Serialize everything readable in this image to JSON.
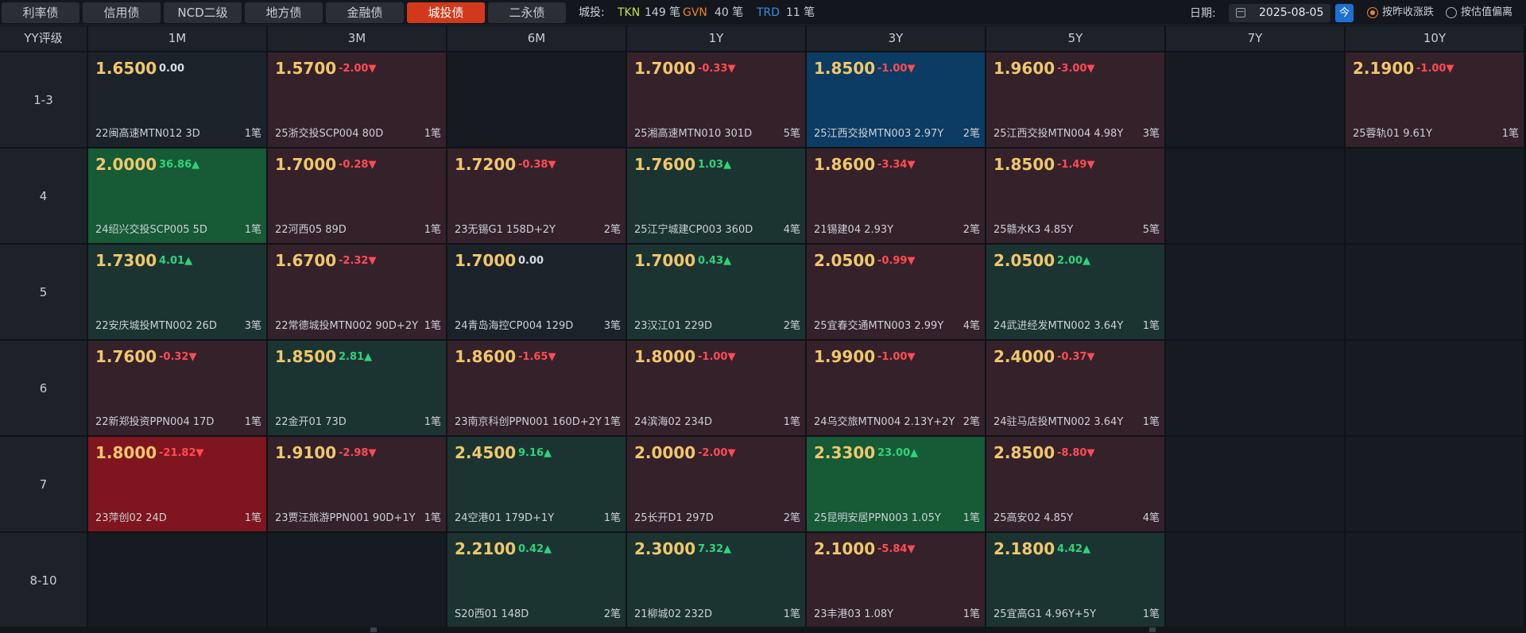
{
  "tabs": [
    {
      "label": "利率债",
      "active": false
    },
    {
      "label": "信用债",
      "active": false
    },
    {
      "label": "NCD二级",
      "active": false
    },
    {
      "label": "地方债",
      "active": false
    },
    {
      "label": "金融债",
      "active": false
    },
    {
      "label": "城投债",
      "active": true
    },
    {
      "label": "二永债",
      "active": false
    }
  ],
  "stats": {
    "label": "城投:",
    "items": [
      {
        "key": "TKN",
        "count": "149 笔",
        "color": "#c4e04b"
      },
      {
        "key": "GVN",
        "count": "40 笔",
        "color": "#e8822a"
      },
      {
        "key": "TRD",
        "count": "11 笔",
        "color": "#3a8fe0"
      }
    ]
  },
  "date": {
    "label": "日期:",
    "value": "2025-08-05",
    "today_label": "今"
  },
  "options": [
    {
      "label": "按昨收涨跌",
      "selected": true
    },
    {
      "label": "按估值偏离",
      "selected": false
    }
  ],
  "colors": {
    "accent": "#d2391c",
    "yield": "#f0c76a",
    "down": "#ff4b55",
    "up": "#2fd37b"
  },
  "grid": {
    "corner": "YY评级",
    "columns": [
      "1M",
      "3M",
      "6M",
      "1Y",
      "3Y",
      "5Y",
      "7Y",
      "10Y"
    ],
    "rows": [
      {
        "label": "1-3",
        "cells": [
          {
            "yield": "1.6500",
            "chg": "0.00",
            "dir": "zero",
            "tone": "flat",
            "name": "22闽高速MTN012 3D",
            "count": "1笔"
          },
          {
            "yield": "1.5700",
            "chg": "-2.00▼",
            "dir": "neg",
            "tone": "down",
            "name": "25浙交投SCP004 80D",
            "count": "1笔"
          },
          null,
          {
            "yield": "1.7000",
            "chg": "-0.33▼",
            "dir": "neg",
            "tone": "down",
            "name": "25湘高速MTN010 301D",
            "count": "5笔"
          },
          {
            "yield": "1.8500",
            "chg": "-1.00▼",
            "dir": "neg",
            "tone": "blue",
            "name": "25江西交投MTN003 2.97Y",
            "count": "2笔"
          },
          {
            "yield": "1.9600",
            "chg": "-3.00▼",
            "dir": "neg",
            "tone": "down",
            "name": "25江西交投MTN004 4.98Y",
            "count": "3笔"
          },
          null,
          {
            "yield": "2.1900",
            "chg": "-1.00▼",
            "dir": "neg",
            "tone": "down",
            "name": "25蓉轨01 9.61Y",
            "count": "1笔"
          }
        ]
      },
      {
        "label": "4",
        "cells": [
          {
            "yield": "2.0000",
            "chg": "36.86▲",
            "dir": "pos",
            "tone": "up-strong",
            "name": "24绍兴交投SCP005 5D",
            "count": "1笔"
          },
          {
            "yield": "1.7000",
            "chg": "-0.28▼",
            "dir": "neg",
            "tone": "down",
            "name": "22河西05 89D",
            "count": "1笔"
          },
          {
            "yield": "1.7200",
            "chg": "-0.38▼",
            "dir": "neg",
            "tone": "down",
            "name": "23无锡G1 158D+2Y",
            "count": "2笔"
          },
          {
            "yield": "1.7600",
            "chg": "1.03▲",
            "dir": "pos",
            "tone": "up",
            "name": "25江宁城建CP003 360D",
            "count": "4笔"
          },
          {
            "yield": "1.8600",
            "chg": "-3.34▼",
            "dir": "neg",
            "tone": "down",
            "name": "21锡建04 2.93Y",
            "count": "2笔"
          },
          {
            "yield": "1.8500",
            "chg": "-1.49▼",
            "dir": "neg",
            "tone": "down",
            "name": "25赣水K3 4.85Y",
            "count": "5笔"
          },
          null,
          null
        ]
      },
      {
        "label": "5",
        "cells": [
          {
            "yield": "1.7300",
            "chg": "4.01▲",
            "dir": "pos",
            "tone": "up",
            "name": "22安庆城投MTN002 26D",
            "count": "3笔"
          },
          {
            "yield": "1.6700",
            "chg": "-2.32▼",
            "dir": "neg",
            "tone": "down",
            "name": "22常德城投MTN002 90D+2Y",
            "count": "1笔"
          },
          {
            "yield": "1.7000",
            "chg": "0.00",
            "dir": "zero",
            "tone": "flat",
            "name": "24青岛海控CP004 129D",
            "count": "3笔"
          },
          {
            "yield": "1.7000",
            "chg": "0.43▲",
            "dir": "pos",
            "tone": "up",
            "name": "23汉江01 229D",
            "count": "2笔"
          },
          {
            "yield": "2.0500",
            "chg": "-0.99▼",
            "dir": "neg",
            "tone": "down",
            "name": "25宜春交通MTN003 2.99Y",
            "count": "4笔"
          },
          {
            "yield": "2.0500",
            "chg": "2.00▲",
            "dir": "pos",
            "tone": "up",
            "name": "24武进经发MTN002 3.64Y",
            "count": "1笔"
          },
          null,
          null
        ]
      },
      {
        "label": "6",
        "cells": [
          {
            "yield": "1.7600",
            "chg": "-0.32▼",
            "dir": "neg",
            "tone": "down",
            "name": "22新郑投资PPN004 17D",
            "count": "1笔"
          },
          {
            "yield": "1.8500",
            "chg": "2.81▲",
            "dir": "pos",
            "tone": "up",
            "name": "22金开01 73D",
            "count": "1笔"
          },
          {
            "yield": "1.8600",
            "chg": "-1.65▼",
            "dir": "neg",
            "tone": "down",
            "name": "23南京科创PPN001 160D+2Y",
            "count": "1笔"
          },
          {
            "yield": "1.8000",
            "chg": "-1.00▼",
            "dir": "neg",
            "tone": "down",
            "name": "24滨海02 234D",
            "count": "1笔"
          },
          {
            "yield": "1.9900",
            "chg": "-1.00▼",
            "dir": "neg",
            "tone": "down",
            "name": "24乌交旅MTN004 2.13Y+2Y",
            "count": "2笔"
          },
          {
            "yield": "2.4000",
            "chg": "-0.37▼",
            "dir": "neg",
            "tone": "down",
            "name": "24驻马店投MTN002 3.64Y",
            "count": "1笔"
          },
          null,
          null
        ]
      },
      {
        "label": "7",
        "cells": [
          {
            "yield": "1.8000",
            "chg": "-21.82▼",
            "dir": "neg",
            "tone": "down-strong",
            "name": "23萍创02 24D",
            "count": "1笔"
          },
          {
            "yield": "1.9100",
            "chg": "-2.98▼",
            "dir": "neg",
            "tone": "down",
            "name": "23贾汪旅游PPN001 90D+1Y",
            "count": "1笔"
          },
          {
            "yield": "2.4500",
            "chg": "9.16▲",
            "dir": "pos",
            "tone": "up",
            "name": "24空港01 179D+1Y",
            "count": "1笔"
          },
          {
            "yield": "2.0000",
            "chg": "-2.00▼",
            "dir": "neg",
            "tone": "down",
            "name": "25长开D1 297D",
            "count": "2笔"
          },
          {
            "yield": "2.3300",
            "chg": "23.00▲",
            "dir": "pos",
            "tone": "up-strong",
            "name": "25昆明安居PPN003 1.05Y",
            "count": "1笔"
          },
          {
            "yield": "2.8500",
            "chg": "-8.80▼",
            "dir": "neg",
            "tone": "down",
            "name": "25高安02 4.85Y",
            "count": "4笔"
          },
          null,
          null
        ]
      },
      {
        "label": "8-10",
        "cells": [
          null,
          null,
          {
            "yield": "2.2100",
            "chg": "0.42▲",
            "dir": "pos",
            "tone": "up",
            "name": "S20西01 148D",
            "count": "2笔"
          },
          {
            "yield": "2.3000",
            "chg": "7.32▲",
            "dir": "pos",
            "tone": "up",
            "name": "21柳城02 232D",
            "count": "1笔"
          },
          {
            "yield": "2.1000",
            "chg": "-5.84▼",
            "dir": "neg",
            "tone": "down",
            "name": "23丰港03 1.08Y",
            "count": "1笔"
          },
          {
            "yield": "2.1800",
            "chg": "4.42▲",
            "dir": "pos",
            "tone": "up",
            "name": "25宜高G1 4.96Y+5Y",
            "count": "1笔"
          },
          null,
          null
        ]
      }
    ]
  }
}
